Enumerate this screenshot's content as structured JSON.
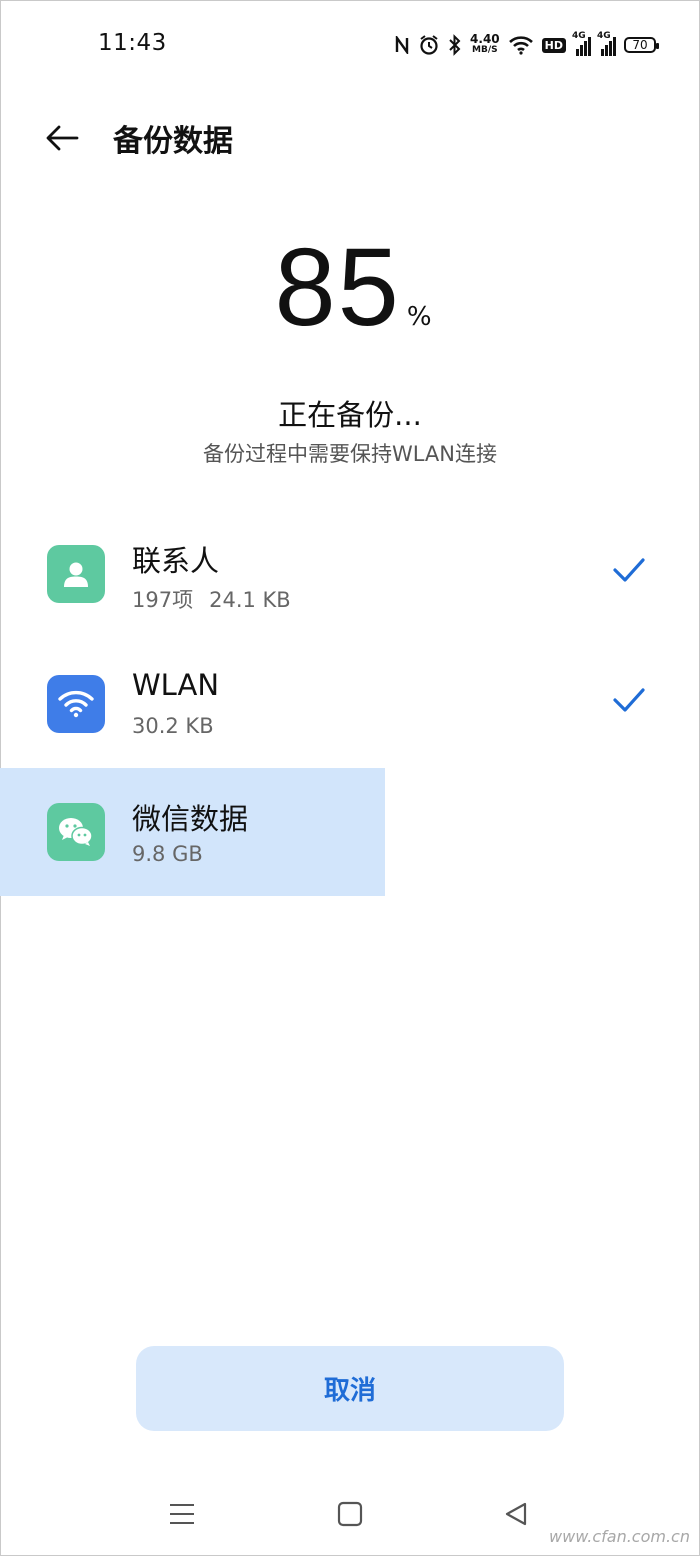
{
  "status_bar": {
    "time": "11:43",
    "net_speed_value": "4.40",
    "net_speed_unit": "MB/S",
    "hd_label": "HD",
    "sim1_label": "4G",
    "sim2_label": "4G",
    "battery": "70"
  },
  "header": {
    "title": "备份数据"
  },
  "progress": {
    "value": "85",
    "unit": "%",
    "status": "正在备份...",
    "note": "备份过程中需要保持WLAN连接"
  },
  "items": [
    {
      "title": "联系人",
      "count": "197项",
      "size": "24.1 KB",
      "icon": "contact-icon",
      "icon_color": "#5ec9a0",
      "done": true
    },
    {
      "title": "WLAN",
      "size": "30.2 KB",
      "icon": "wifi-icon",
      "icon_color": "#3f7de8",
      "done": true
    },
    {
      "title": "微信数据",
      "size": "9.8 GB",
      "icon": "wechat-icon",
      "icon_color": "#5ec9a0",
      "done": false
    }
  ],
  "actions": {
    "cancel": "取消"
  },
  "colors": {
    "accent": "#1f6cd6",
    "highlight": "#d2e5fb",
    "button_bg": "#d8e8fb"
  },
  "watermark": "www.cfan.com.cn"
}
